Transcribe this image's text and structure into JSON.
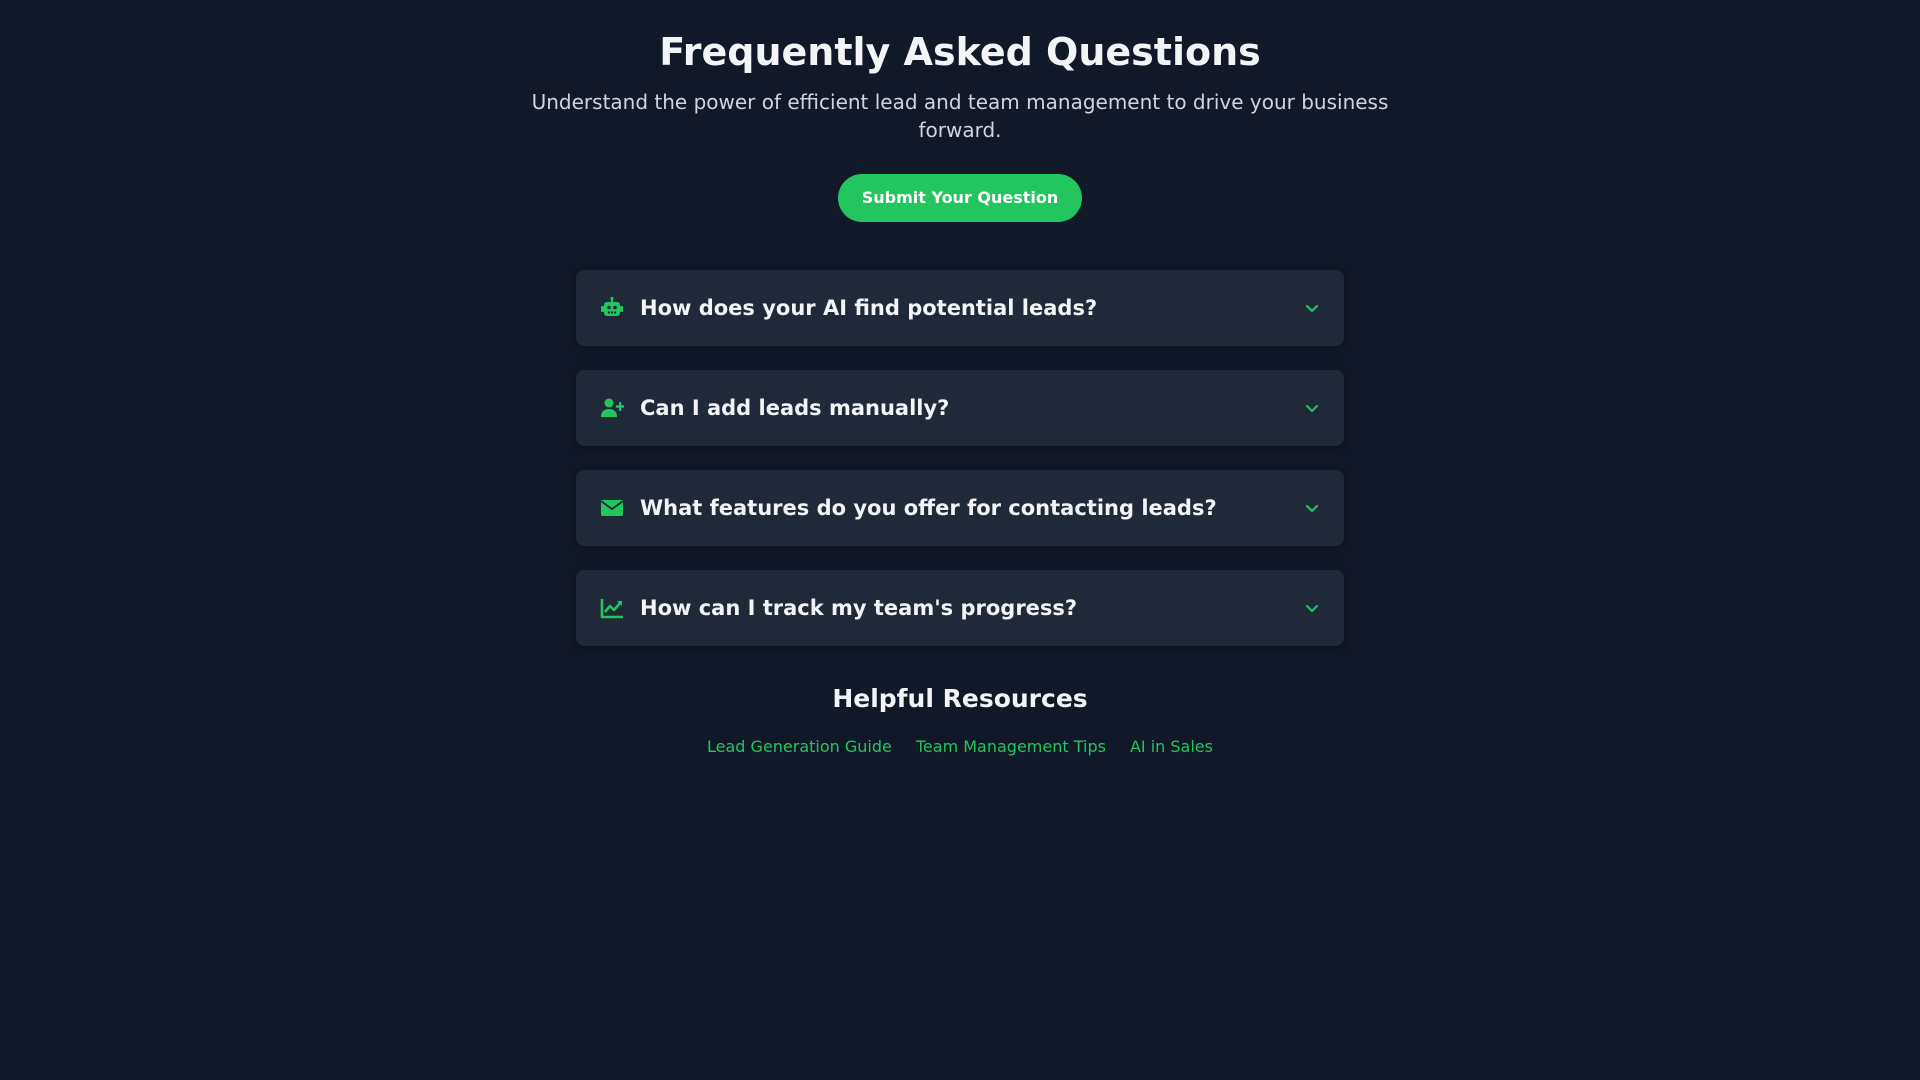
{
  "header": {
    "title": "Frequently Asked Questions",
    "subtitle": "Understand the power of efficient lead and team management to drive your business forward."
  },
  "cta": {
    "submit_label": "Submit Your Question"
  },
  "faq": {
    "items": [
      {
        "icon": "robot-icon",
        "question": "How does your AI find potential leads?"
      },
      {
        "icon": "user-plus-icon",
        "question": "Can I add leads manually?"
      },
      {
        "icon": "envelope-icon",
        "question": "What features do you offer for contacting leads?"
      },
      {
        "icon": "chart-line-icon",
        "question": "How can I track my team's progress?"
      }
    ]
  },
  "resources": {
    "title": "Helpful Resources",
    "links": [
      "Lead Generation Guide",
      "Team Management Tips",
      "AI in Sales"
    ]
  },
  "colors": {
    "background": "#111827",
    "card": "#1f2937",
    "accent": "#22c55e",
    "text": "#f3f4f6",
    "muted": "#d1d5db"
  }
}
